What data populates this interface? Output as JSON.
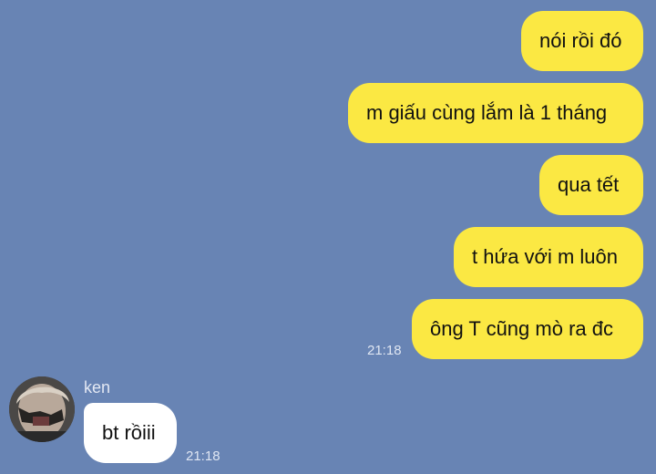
{
  "chat": {
    "outgoing": [
      {
        "text": "nói rồi đó"
      },
      {
        "text": "m giấu cùng lắm là 1 tháng"
      },
      {
        "text": "qua tết"
      },
      {
        "text": "t hứa với m luôn"
      },
      {
        "text": "ông T cũng mò ra đc"
      }
    ],
    "outgoing_time": "21:18",
    "incoming": {
      "sender": "ken",
      "avatar_icon": "user-photo-avatar",
      "text": "bt rồiii",
      "time": "21:18"
    }
  },
  "colors": {
    "background": "#6884b4",
    "outgoing_bubble": "#fbe843",
    "incoming_bubble": "#ffffff"
  }
}
